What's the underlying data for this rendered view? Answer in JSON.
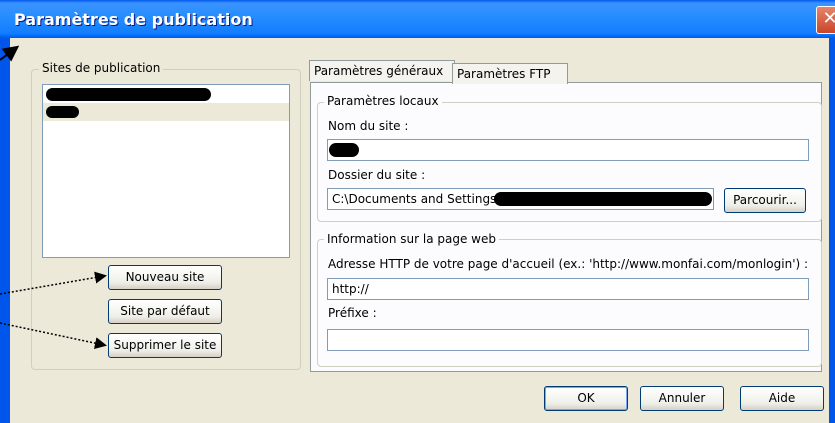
{
  "window": {
    "title": "Paramètres de publication",
    "close_icon": "close-icon"
  },
  "sites": {
    "legend": "Sites de publication",
    "items": [
      {
        "label": "",
        "redacted": true
      },
      {
        "label": "",
        "redacted": true
      }
    ],
    "buttons": {
      "new": "Nouveau site",
      "default": "Site par défaut",
      "delete": "Supprimer le site"
    }
  },
  "tabs": [
    {
      "label": "Paramètres généraux",
      "active": true
    },
    {
      "label": "Paramètres FTP",
      "active": false
    }
  ],
  "local": {
    "legend": "Paramètres locaux",
    "site_name_label": "Nom du site :",
    "site_name_value": "",
    "folder_label": "Dossier du site :",
    "folder_value": "C:\\Documents and Settings\\",
    "browse": "Parcourir..."
  },
  "web": {
    "legend": "Information sur la page web",
    "http_label": "Adresse HTTP de votre page d'accueil (ex.: 'http://www.monfai.com/monlogin') :",
    "http_value": "http://",
    "prefix_label": "Préfixe :",
    "prefix_value": ""
  },
  "footer": {
    "ok": "OK",
    "cancel": "Annuler",
    "help": "Aide"
  }
}
